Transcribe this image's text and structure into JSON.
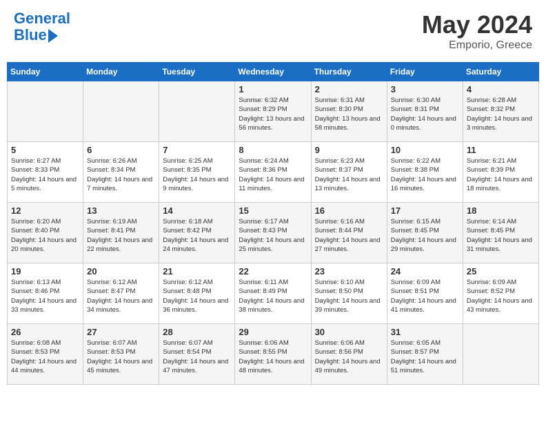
{
  "header": {
    "logo_line1": "General",
    "logo_line2": "Blue",
    "month": "May 2024",
    "location": "Emporio, Greece"
  },
  "days_of_week": [
    "Sunday",
    "Monday",
    "Tuesday",
    "Wednesday",
    "Thursday",
    "Friday",
    "Saturday"
  ],
  "weeks": [
    [
      {
        "day": "",
        "sunrise": "",
        "sunset": "",
        "daylight": ""
      },
      {
        "day": "",
        "sunrise": "",
        "sunset": "",
        "daylight": ""
      },
      {
        "day": "",
        "sunrise": "",
        "sunset": "",
        "daylight": ""
      },
      {
        "day": "1",
        "sunrise": "Sunrise: 6:32 AM",
        "sunset": "Sunset: 8:29 PM",
        "daylight": "Daylight: 13 hours and 56 minutes."
      },
      {
        "day": "2",
        "sunrise": "Sunrise: 6:31 AM",
        "sunset": "Sunset: 8:30 PM",
        "daylight": "Daylight: 13 hours and 58 minutes."
      },
      {
        "day": "3",
        "sunrise": "Sunrise: 6:30 AM",
        "sunset": "Sunset: 8:31 PM",
        "daylight": "Daylight: 14 hours and 0 minutes."
      },
      {
        "day": "4",
        "sunrise": "Sunrise: 6:28 AM",
        "sunset": "Sunset: 8:32 PM",
        "daylight": "Daylight: 14 hours and 3 minutes."
      }
    ],
    [
      {
        "day": "5",
        "sunrise": "Sunrise: 6:27 AM",
        "sunset": "Sunset: 8:33 PM",
        "daylight": "Daylight: 14 hours and 5 minutes."
      },
      {
        "day": "6",
        "sunrise": "Sunrise: 6:26 AM",
        "sunset": "Sunset: 8:34 PM",
        "daylight": "Daylight: 14 hours and 7 minutes."
      },
      {
        "day": "7",
        "sunrise": "Sunrise: 6:25 AM",
        "sunset": "Sunset: 8:35 PM",
        "daylight": "Daylight: 14 hours and 9 minutes."
      },
      {
        "day": "8",
        "sunrise": "Sunrise: 6:24 AM",
        "sunset": "Sunset: 8:36 PM",
        "daylight": "Daylight: 14 hours and 11 minutes."
      },
      {
        "day": "9",
        "sunrise": "Sunrise: 6:23 AM",
        "sunset": "Sunset: 8:37 PM",
        "daylight": "Daylight: 14 hours and 13 minutes."
      },
      {
        "day": "10",
        "sunrise": "Sunrise: 6:22 AM",
        "sunset": "Sunset: 8:38 PM",
        "daylight": "Daylight: 14 hours and 16 minutes."
      },
      {
        "day": "11",
        "sunrise": "Sunrise: 6:21 AM",
        "sunset": "Sunset: 8:39 PM",
        "daylight": "Daylight: 14 hours and 18 minutes."
      }
    ],
    [
      {
        "day": "12",
        "sunrise": "Sunrise: 6:20 AM",
        "sunset": "Sunset: 8:40 PM",
        "daylight": "Daylight: 14 hours and 20 minutes."
      },
      {
        "day": "13",
        "sunrise": "Sunrise: 6:19 AM",
        "sunset": "Sunset: 8:41 PM",
        "daylight": "Daylight: 14 hours and 22 minutes."
      },
      {
        "day": "14",
        "sunrise": "Sunrise: 6:18 AM",
        "sunset": "Sunset: 8:42 PM",
        "daylight": "Daylight: 14 hours and 24 minutes."
      },
      {
        "day": "15",
        "sunrise": "Sunrise: 6:17 AM",
        "sunset": "Sunset: 8:43 PM",
        "daylight": "Daylight: 14 hours and 25 minutes."
      },
      {
        "day": "16",
        "sunrise": "Sunrise: 6:16 AM",
        "sunset": "Sunset: 8:44 PM",
        "daylight": "Daylight: 14 hours and 27 minutes."
      },
      {
        "day": "17",
        "sunrise": "Sunrise: 6:15 AM",
        "sunset": "Sunset: 8:45 PM",
        "daylight": "Daylight: 14 hours and 29 minutes."
      },
      {
        "day": "18",
        "sunrise": "Sunrise: 6:14 AM",
        "sunset": "Sunset: 8:45 PM",
        "daylight": "Daylight: 14 hours and 31 minutes."
      }
    ],
    [
      {
        "day": "19",
        "sunrise": "Sunrise: 6:13 AM",
        "sunset": "Sunset: 8:46 PM",
        "daylight": "Daylight: 14 hours and 33 minutes."
      },
      {
        "day": "20",
        "sunrise": "Sunrise: 6:12 AM",
        "sunset": "Sunset: 8:47 PM",
        "daylight": "Daylight: 14 hours and 34 minutes."
      },
      {
        "day": "21",
        "sunrise": "Sunrise: 6:12 AM",
        "sunset": "Sunset: 8:48 PM",
        "daylight": "Daylight: 14 hours and 36 minutes."
      },
      {
        "day": "22",
        "sunrise": "Sunrise: 6:11 AM",
        "sunset": "Sunset: 8:49 PM",
        "daylight": "Daylight: 14 hours and 38 minutes."
      },
      {
        "day": "23",
        "sunrise": "Sunrise: 6:10 AM",
        "sunset": "Sunset: 8:50 PM",
        "daylight": "Daylight: 14 hours and 39 minutes."
      },
      {
        "day": "24",
        "sunrise": "Sunrise: 6:09 AM",
        "sunset": "Sunset: 8:51 PM",
        "daylight": "Daylight: 14 hours and 41 minutes."
      },
      {
        "day": "25",
        "sunrise": "Sunrise: 6:09 AM",
        "sunset": "Sunset: 8:52 PM",
        "daylight": "Daylight: 14 hours and 43 minutes."
      }
    ],
    [
      {
        "day": "26",
        "sunrise": "Sunrise: 6:08 AM",
        "sunset": "Sunset: 8:53 PM",
        "daylight": "Daylight: 14 hours and 44 minutes."
      },
      {
        "day": "27",
        "sunrise": "Sunrise: 6:07 AM",
        "sunset": "Sunset: 8:53 PM",
        "daylight": "Daylight: 14 hours and 45 minutes."
      },
      {
        "day": "28",
        "sunrise": "Sunrise: 6:07 AM",
        "sunset": "Sunset: 8:54 PM",
        "daylight": "Daylight: 14 hours and 47 minutes."
      },
      {
        "day": "29",
        "sunrise": "Sunrise: 6:06 AM",
        "sunset": "Sunset: 8:55 PM",
        "daylight": "Daylight: 14 hours and 48 minutes."
      },
      {
        "day": "30",
        "sunrise": "Sunrise: 6:06 AM",
        "sunset": "Sunset: 8:56 PM",
        "daylight": "Daylight: 14 hours and 49 minutes."
      },
      {
        "day": "31",
        "sunrise": "Sunrise: 6:05 AM",
        "sunset": "Sunset: 8:57 PM",
        "daylight": "Daylight: 14 hours and 51 minutes."
      },
      {
        "day": "",
        "sunrise": "",
        "sunset": "",
        "daylight": ""
      }
    ]
  ]
}
